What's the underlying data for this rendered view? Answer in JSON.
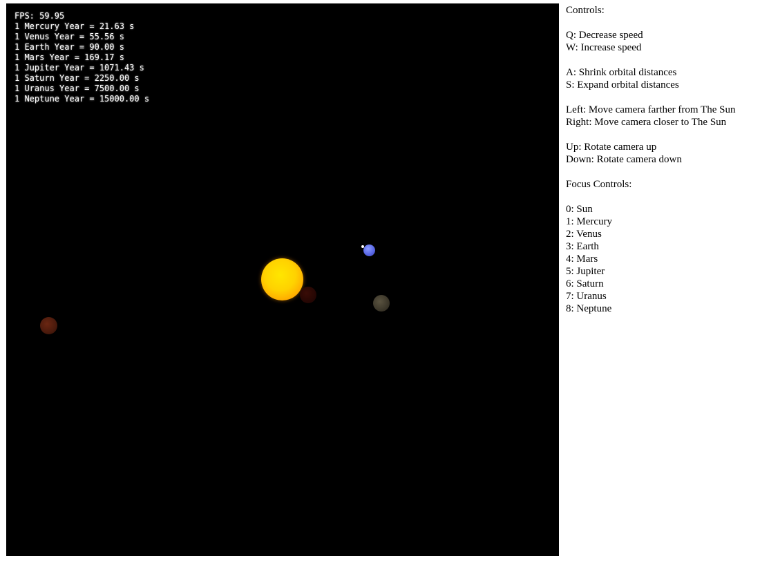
{
  "stats": {
    "fps": "FPS: 59.95",
    "years": [
      "1 Mercury Year = 21.63 s",
      "1 Venus Year = 55.56 s",
      "1 Earth Year = 90.00 s",
      "1 Mars Year = 169.17 s",
      "1 Jupiter Year = 1071.43 s",
      "1 Saturn Year = 2250.00 s",
      "1 Uranus Year = 7500.00 s",
      "1 Neptune Year = 15000.00 s"
    ]
  },
  "controls": {
    "title": "Controls:",
    "speed": [
      "Q: Decrease speed",
      "W: Increase speed"
    ],
    "distance": [
      "A: Shrink orbital distances",
      "S: Expand orbital distances"
    ],
    "camera_distance": [
      "Left: Move camera farther from The Sun",
      "Right: Move camera closer to The Sun"
    ],
    "camera_rotate": [
      "Up: Rotate camera up",
      "Down: Rotate camera down"
    ],
    "focus_title": "Focus Controls:",
    "focus": [
      "0: Sun",
      "1: Mercury",
      "2: Venus",
      "3: Earth",
      "4: Mars",
      "5: Jupiter",
      "6: Saturn",
      "7: Uranus",
      "8: Neptune"
    ]
  },
  "colors": {
    "scene_background": "#000000",
    "sun": "#ffc400",
    "earth": "#6a78f0",
    "text_overlay": "#ffffff"
  }
}
